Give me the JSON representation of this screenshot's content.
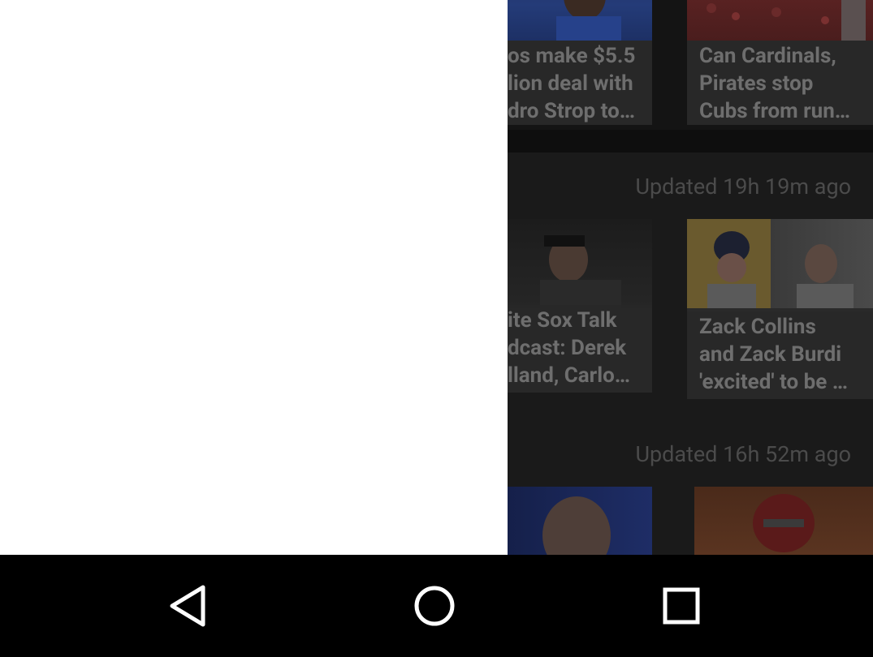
{
  "feed": {
    "sections": [
      {
        "updated": "",
        "cards": [
          {
            "title": "os make $5.5\nlion deal with\ndro Strop to…",
            "photo_icon": "baseball-pitcher-blue-jersey-photo"
          },
          {
            "title": "Can Cardinals,\nPirates stop\nCubs from run…",
            "photo_icon": "stadium-crowd-red-photo"
          }
        ]
      },
      {
        "updated": "Updated 19h 19m ago",
        "cards": [
          {
            "title": "ite Sox Talk\ndcast: Derek\nlland, Carlo…",
            "photo_icon": "pitcher-white-sox-photo"
          },
          {
            "title": "Zack Collins\nand Zack Burdi\n'excited' to be …",
            "photo_icon": "players-pinstripes-photo"
          }
        ]
      },
      {
        "updated": "Updated 16h 52m ago",
        "cards": [
          {
            "title": "",
            "photo_icon": "bald-man-portrait-photo"
          },
          {
            "title": "",
            "photo_icon": "football-player-red-helmet-photo"
          }
        ]
      }
    ]
  },
  "navbar": {
    "back": "back-icon",
    "home": "home-icon",
    "recents": "recents-icon"
  },
  "colors": {
    "drawer_bg": "#ffffff",
    "content_bg": "#141414",
    "navbar_bg": "#000000",
    "nav_icon": "#ffffff"
  }
}
